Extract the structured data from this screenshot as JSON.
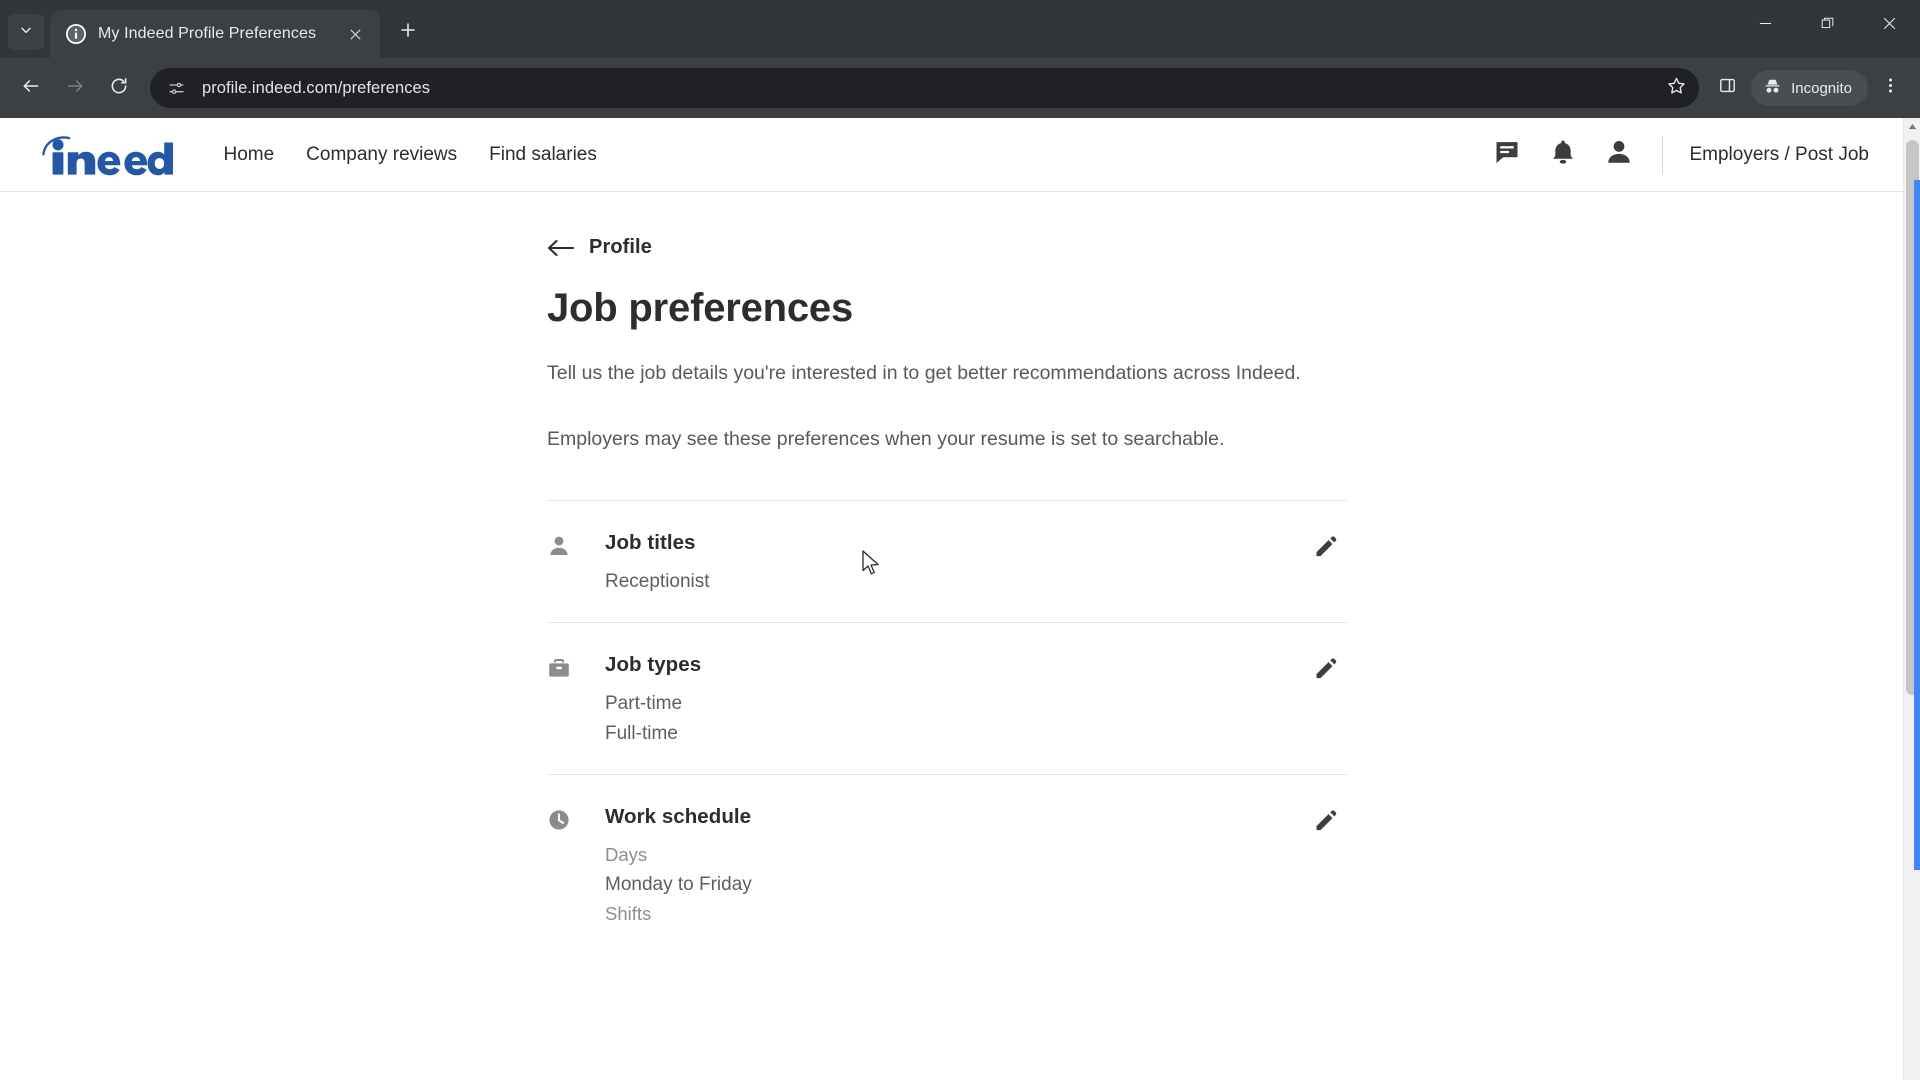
{
  "browser": {
    "tab": {
      "title": "My Indeed Profile Preferences",
      "favicon_icon": "info-circle-icon",
      "close_icon": "close-icon"
    },
    "tab_search_icon": "chevron-down-icon",
    "new_tab_icon": "plus-icon",
    "window_controls": {
      "minimize_icon": "minimize-icon",
      "maximize_icon": "restore-icon",
      "close_icon": "close-icon"
    },
    "toolbar": {
      "back_icon": "back-arrow-icon",
      "forward_icon": "forward-arrow-icon",
      "reload_icon": "reload-icon",
      "site_info_icon": "page-settings-icon",
      "url": "profile.indeed.com/preferences",
      "bookmark_icon": "star-icon",
      "side_panel_icon": "side-panel-icon",
      "incognito_label": "Incognito",
      "incognito_icon": "incognito-hat-icon",
      "menu_icon": "three-dots-vertical-icon"
    }
  },
  "site": {
    "logo_text": "indeed",
    "logo_color": "#2557a7",
    "nav": [
      {
        "label": "Home"
      },
      {
        "label": "Company reviews"
      },
      {
        "label": "Find salaries"
      }
    ],
    "header_icons": [
      {
        "name": "messages-icon"
      },
      {
        "name": "notifications-bell-icon"
      },
      {
        "name": "account-avatar-icon"
      }
    ],
    "employers_link": "Employers / Post Job"
  },
  "main": {
    "back_label": "Profile",
    "back_icon": "left-arrow-icon",
    "title": "Job preferences",
    "intro": "Tell us the job details you're interested in to get better recommendations across Indeed.",
    "notice": "Employers may see these preferences when your resume is set to searchable.",
    "edit_icon": "pencil-icon",
    "preferences": [
      {
        "icon": "person-icon",
        "heading": "Job titles",
        "lines": [
          {
            "text": "Receptionist",
            "style": "value"
          }
        ]
      },
      {
        "icon": "briefcase-icon",
        "heading": "Job types",
        "lines": [
          {
            "text": "Part-time",
            "style": "value"
          },
          {
            "text": "Full-time",
            "style": "value"
          }
        ]
      },
      {
        "icon": "clock-icon",
        "heading": "Work schedule",
        "lines": [
          {
            "text": "Days",
            "style": "sublabel"
          },
          {
            "text": "Monday to Friday",
            "style": "value"
          },
          {
            "text": "Shifts",
            "style": "sublabel"
          }
        ]
      }
    ]
  }
}
